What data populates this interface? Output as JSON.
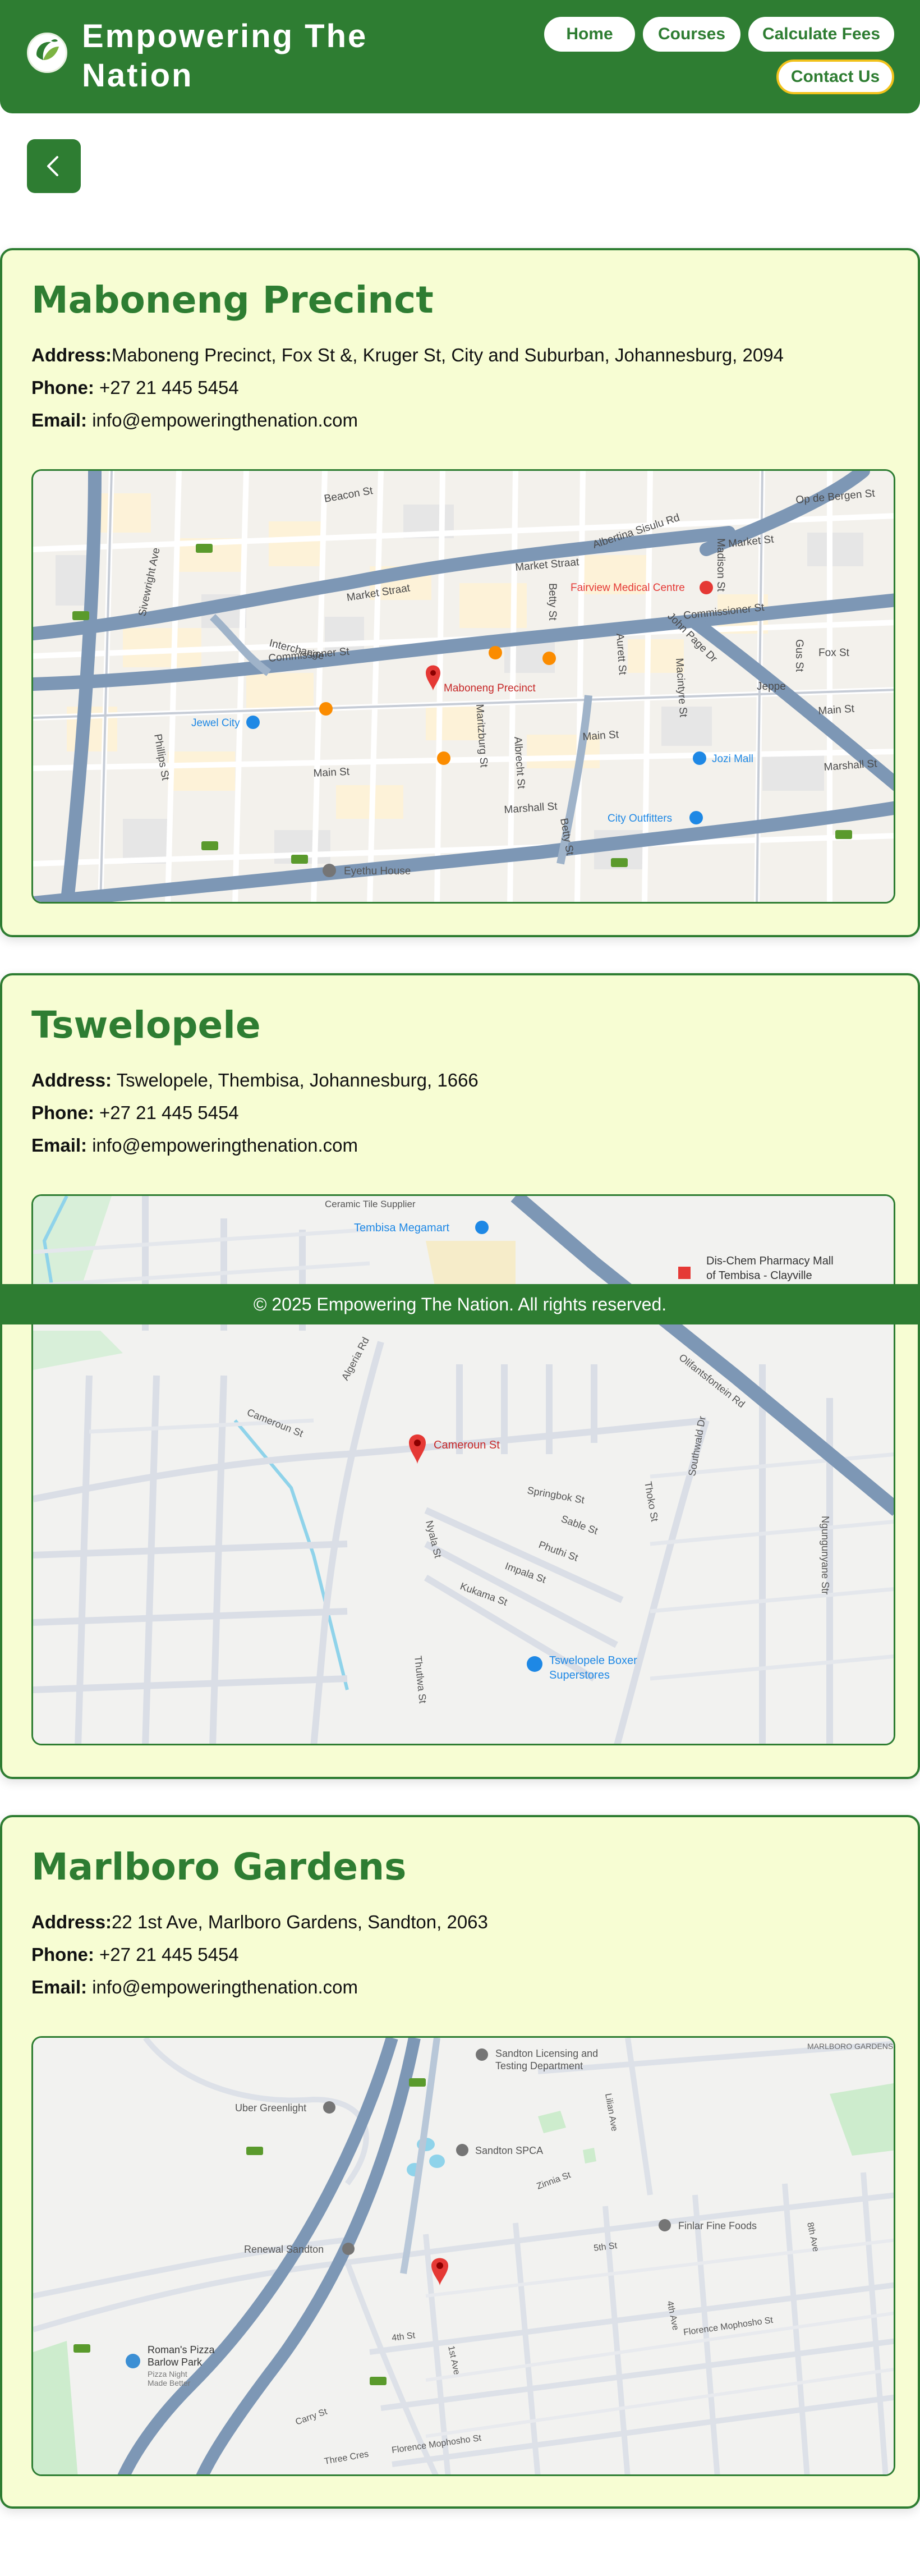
{
  "header": {
    "brand_line1": "Empowering The",
    "brand_line2": "Nation",
    "nav": {
      "home": "Home",
      "courses": "Courses",
      "fees": "Calculate Fees",
      "contact": "Contact Us"
    }
  },
  "back_button": {
    "icon": "chevron-left-icon"
  },
  "locations": [
    {
      "title": "Maboneng Precinct",
      "address_label": "Address:",
      "address": "Maboneng Precinct, Fox St &, Kruger St, City and Suburban, Johannesburg, 2094",
      "phone_label": "Phone:",
      "phone": "+27 21 445 5454",
      "email_label": "Email:",
      "email": "info@empoweringthenation.com",
      "map_labels": {
        "pin": "Maboneng Precinct",
        "medical": "Fairview Medical Centre",
        "jewel": "Jewel City",
        "jozi": "Jozi Mall",
        "outfitters": "City Outfitters",
        "eyethu": "Eyethu House",
        "market": "Market Straat",
        "market2": "Market Straat",
        "commissioner": "Commissioner St",
        "interchange": "Interchange",
        "main": "Main St",
        "main2": "Main St",
        "marshall": "Marshall St",
        "albertina": "Albertina Sisulu Rd",
        "jeppe": "Jeppe",
        "beacon": "Beacon St",
        "op_de_bergen": "Op de Bergen St",
        "market_st": "Market St",
        "fox": "Fox St",
        "gus": "Gus St",
        "madison": "Madison St",
        "betty": "Betty St",
        "albrecht": "Albrecht St",
        "maritzburg": "Maritzburg St",
        "aurett": "Aurett St",
        "macintyre": "Macintyre St",
        "john_page": "John Page Dr",
        "sivewright": "Sivewright Ave",
        "phillips": "Phillips St"
      }
    },
    {
      "title": "Tswelopele",
      "address_label": "Address:",
      "address": "Tswelopele, Thembisa, Johannesburg, 1666",
      "phone_label": "Phone:",
      "phone": "+27 21 445 5454",
      "email_label": "Email:",
      "email": "info@empoweringthenation.com",
      "map_labels": {
        "pin": "Cameroun St",
        "ceramic": "Ceramic Tile Supplier",
        "megamart": "Tembisa Megamart",
        "dischem_1": "Dis-Chem Pharmacy Mall",
        "dischem_2": "of Tembisa - Clayville",
        "boxer_1": "Tswelopele Boxer",
        "boxer_2": "Superstores",
        "olifantsfontein": "Olifantsfontein Rd",
        "cameroon": "Cameroun St",
        "algeria": "Algeria Rd",
        "springbok": "Springbok St",
        "sable": "Sable St",
        "phuthi": "Phuthi St",
        "impala": "Impala St",
        "kukama": "Kukama St",
        "nyala": "Nyala St",
        "thoko": "Thoko St",
        "southwald": "Southwald Dr",
        "thutlwa": "Thutlwa St",
        "ngungunyane": "Ngungunyane Str"
      }
    },
    {
      "title": "Marlboro Gardens",
      "address_label": "Address:",
      "address": "22 1st Ave, Marlboro Gardens, Sandton, 2063",
      "phone_label": "Phone:",
      "phone": "+27 21 445 5454",
      "email_label": "Email:",
      "email": "info@empoweringthenation.com",
      "map_labels": {
        "licensing_1": "Sandton Licensing and",
        "licensing_2": "Testing Department",
        "spca": "Sandton SPCA",
        "uber": "Uber Greenlight",
        "renewal": "Renewal Sandton",
        "finlar": "Finlar Fine Foods",
        "pizza_1": "Roman's Pizza",
        "pizza_2": "Barlow Park",
        "pizza_3": "Pizza Night",
        "pizza_4": "Made Better",
        "marlboro": "MARLBORO GARDENS",
        "zinnia": "Zinnia St",
        "fifth": "5th St",
        "fourth_st": "4th St",
        "first_ave": "1st Ave",
        "fourth_ave": "4th Ave",
        "eighth_ave": "8th Ave",
        "florence": "Florence Mophosho St",
        "florence2": "Florence Mophosho St",
        "carry": "Carry St",
        "three_cres": "Three Cres",
        "lilian": "Lilian Ave"
      }
    }
  ],
  "footer": {
    "text": "© 2025 Empowering The Nation. All rights reserved."
  },
  "colors": {
    "primary_green": "#2e7d32",
    "card_bg": "#f7fdd3",
    "contact_border": "#f2c21b"
  }
}
